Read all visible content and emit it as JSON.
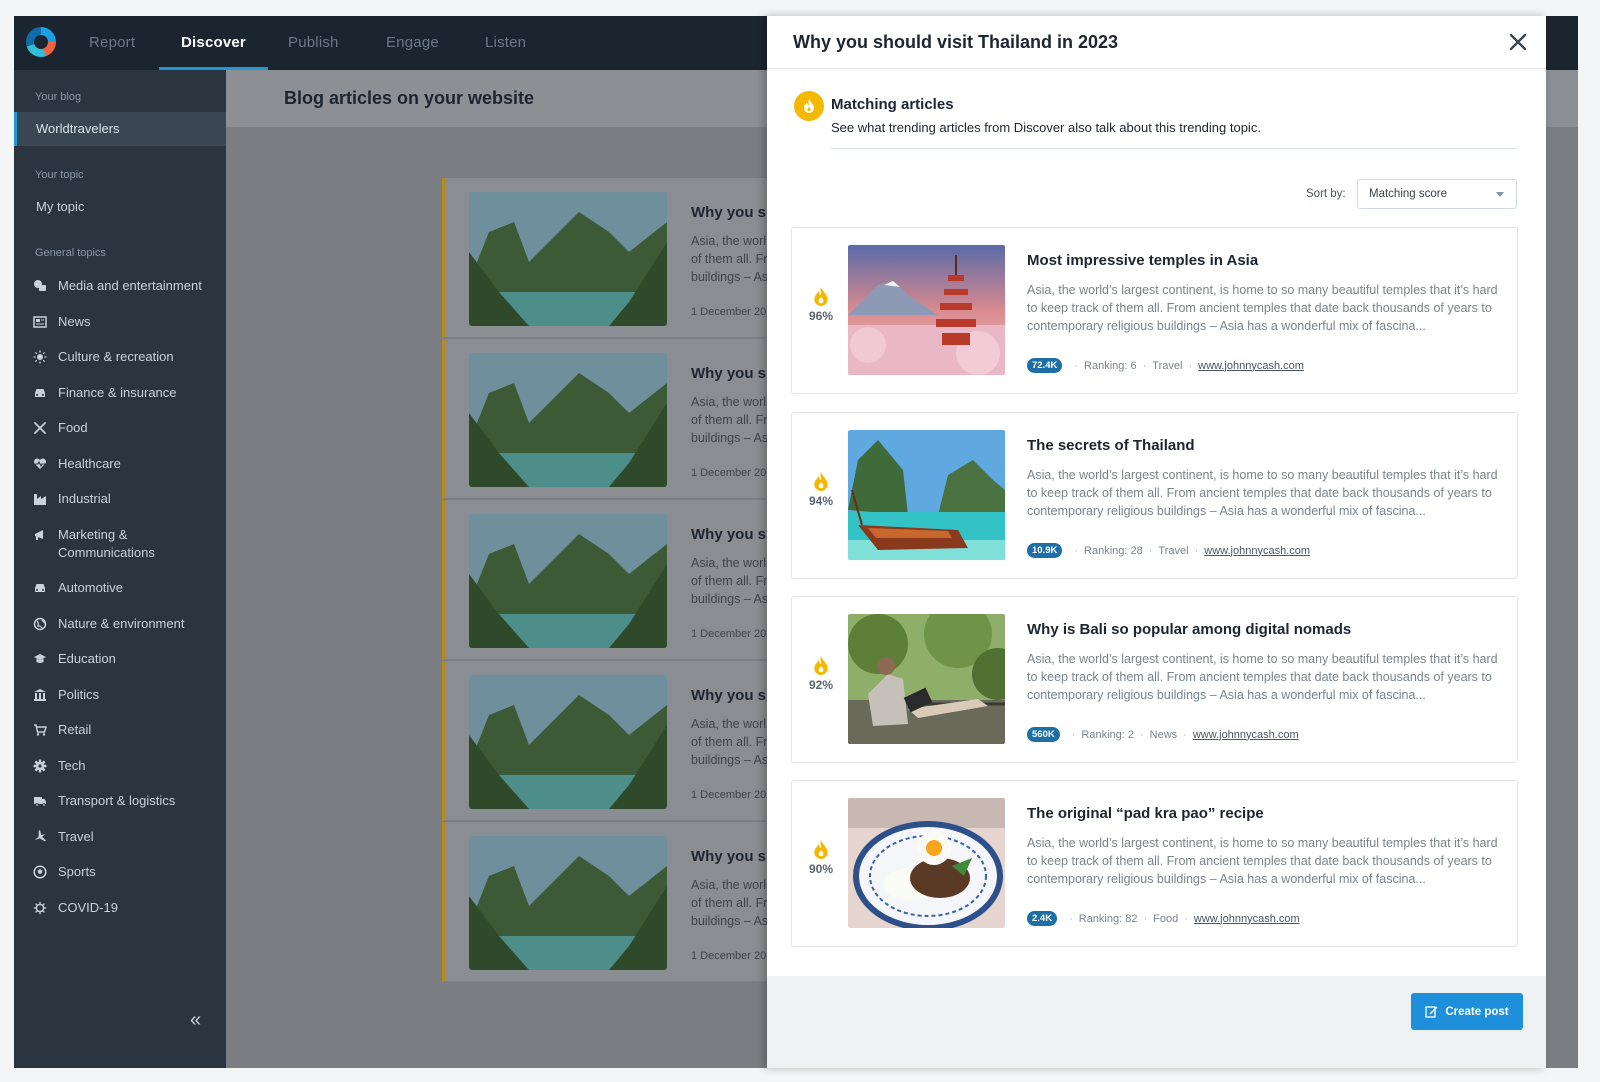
{
  "nav": {
    "tabs": [
      {
        "label": "Report"
      },
      {
        "label": "Discover",
        "active": true
      },
      {
        "label": "Publish"
      },
      {
        "label": "Engage"
      },
      {
        "label": "Listen"
      }
    ]
  },
  "sidebar": {
    "your_blog_heading": "Your blog",
    "blog_name": "Worldtravelers",
    "your_topic_heading": "Your topic",
    "topic_name": "My topic",
    "general_topics_heading": "General topics",
    "topics": [
      {
        "label": "Media and entertainment",
        "icon": "media-icon"
      },
      {
        "label": "News",
        "icon": "newspaper-icon"
      },
      {
        "label": "Culture & recreation",
        "icon": "sun-icon"
      },
      {
        "label": "Finance & insurance",
        "icon": "car-icon"
      },
      {
        "label": "Food",
        "icon": "utensils-icon"
      },
      {
        "label": "Healthcare",
        "icon": "heart-pulse-icon"
      },
      {
        "label": "Industrial",
        "icon": "factory-icon"
      },
      {
        "label": "Marketing & Communications",
        "icon": "megaphone-icon"
      },
      {
        "label": "Automotive",
        "icon": "car-icon"
      },
      {
        "label": "Nature & environment",
        "icon": "globe-icon"
      },
      {
        "label": "Education",
        "icon": "graduation-cap-icon"
      },
      {
        "label": "Politics",
        "icon": "institution-icon"
      },
      {
        "label": "Retail",
        "icon": "cart-icon"
      },
      {
        "label": "Tech",
        "icon": "cog-icon"
      },
      {
        "label": "Transport & logistics",
        "icon": "truck-icon"
      },
      {
        "label": "Travel",
        "icon": "plane-icon"
      },
      {
        "label": "Sports",
        "icon": "ball-icon"
      },
      {
        "label": "COVID-19",
        "icon": "virus-icon"
      }
    ],
    "collapse_glyph": "«"
  },
  "main": {
    "title": "Blog articles on your website",
    "blog_cards": [
      {
        "title": "Why you sh",
        "excerpt_lines": [
          "Asia, the worl",
          "of them all. Fr",
          "buildings – As"
        ],
        "date": "1 December 20"
      },
      {
        "title": "Why you sh",
        "excerpt_lines": [
          "Asia, the worl",
          "of them all. Fr",
          "buildings – As"
        ],
        "date": "1 December 20"
      },
      {
        "title": "Why you sh",
        "excerpt_lines": [
          "Asia, the worl",
          "of them all. Fr",
          "buildings – As"
        ],
        "date": "1 December 20"
      },
      {
        "title": "Why you sh",
        "excerpt_lines": [
          "Asia, the worl",
          "of them all. Fr",
          "buildings – As"
        ],
        "date": "1 December 20"
      },
      {
        "title": "Why you sh",
        "excerpt_lines": [
          "Asia, the worl",
          "of them all. Fr",
          "buildings – As"
        ],
        "date": "1 December 20"
      }
    ]
  },
  "drawer": {
    "title": "Why you should visit Thailand in 2023",
    "matching": {
      "title": "Matching articles",
      "subtitle": "See what trending articles from Discover also talk about this trending topic."
    },
    "sort": {
      "label": "Sort by:",
      "selected": "Matching score"
    },
    "articles": [
      {
        "score": "96%",
        "title": "Most impressive temples in Asia",
        "excerpt": "Asia, the world’s largest continent, is home to so many beautiful temples that it’s hard to keep track of them all. From ancient temples that date back thousands of years to contemporary religious buildings – Asia has a wonderful mix of fascina...",
        "badge": "72.4K",
        "ranking": "Ranking: 6",
        "category": "Travel",
        "url": "www.johnnycash.com"
      },
      {
        "score": "94%",
        "title": "The secrets of Thailand",
        "excerpt": "Asia, the world’s largest continent, is home to so many beautiful temples that it’s hard to keep track of them all. From ancient temples that date back thousands of years to contemporary religious buildings – Asia has a wonderful mix of fascina...",
        "badge": "10.9K",
        "ranking": "Ranking: 28",
        "category": "Travel",
        "url": "www.johnnycash.com"
      },
      {
        "score": "92%",
        "title": "Why is Bali so popular among digital nomads",
        "excerpt": "Asia, the world’s largest continent, is home to so many beautiful temples that it’s hard to keep track of them all. From ancient temples that date back thousands of years to contemporary religious buildings – Asia has a wonderful mix of fascina...",
        "badge": "560K",
        "ranking": "Ranking: 2",
        "category": "News",
        "url": "www.johnnycash.com"
      },
      {
        "score": "90%",
        "title": "The original “pad kra pao” recipe",
        "excerpt": "Asia, the world’s largest continent, is home to so many beautiful temples that it’s hard to keep track of them all. From ancient temples that date back thousands of years to contemporary religious buildings – Asia has a wonderful mix of fascina...",
        "badge": "2.4K",
        "ranking": "Ranking: 82",
        "category": "Food",
        "url": "www.johnnycash.com"
      }
    ],
    "create_button": "Create post"
  },
  "colors": {
    "accent": "#1d8fdb",
    "flame": "#f5b800",
    "badge": "#1e6fa6",
    "nav_bg": "#1b2530",
    "sidebar_bg": "#2b3540"
  }
}
